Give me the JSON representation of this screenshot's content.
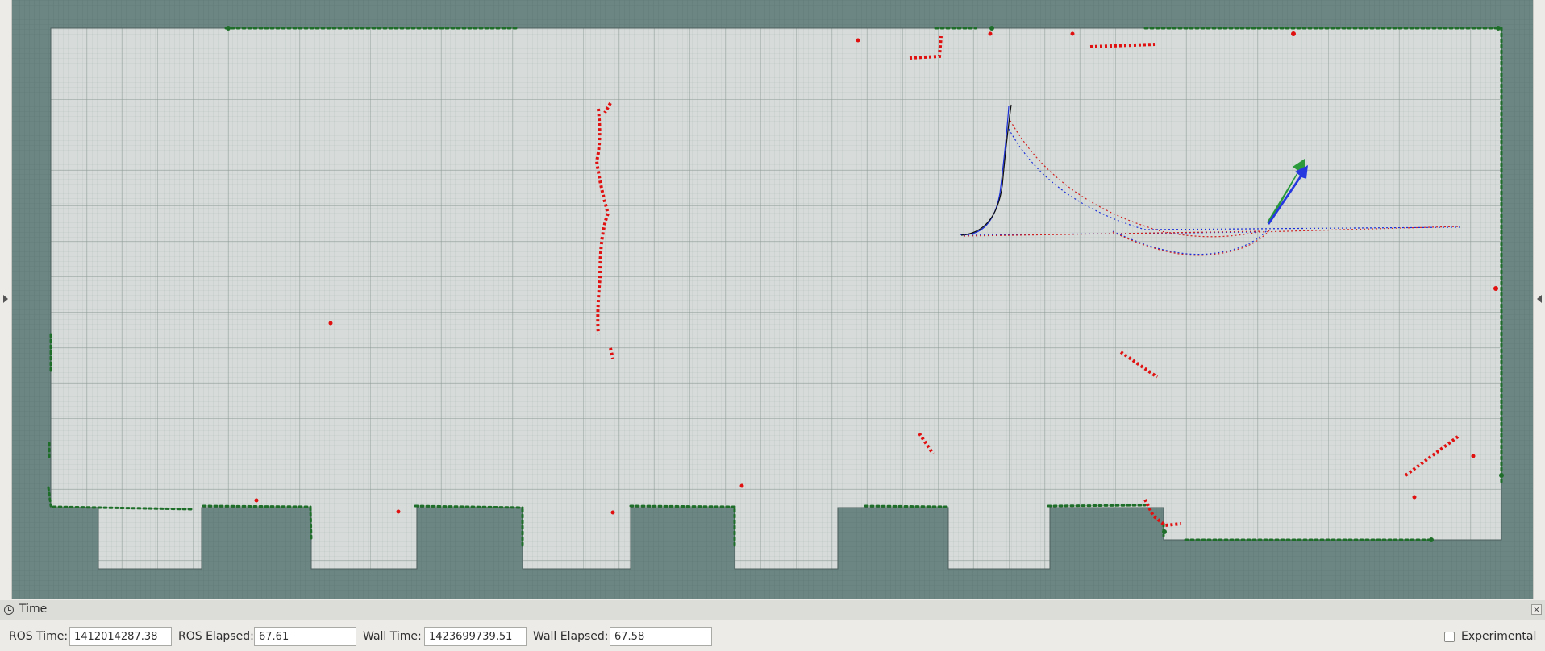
{
  "app": "rviz",
  "colors": {
    "unknown": "#6d8a87",
    "free": "#d7dcda",
    "obstacle_wall": "#1e6e2a",
    "laser": "#e01010",
    "path_blue": "#1a2ed8",
    "path_red": "#d02020",
    "pose_arrow_green": "#2a9a3a",
    "pose_arrow_blue": "#2538e0"
  },
  "time_panel": {
    "title": "Time",
    "ros_time_label": "ROS Time:",
    "ros_time_value": "1412014287.38",
    "ros_elapsed_label": "ROS Elapsed:",
    "ros_elapsed_value": "67.61",
    "wall_time_label": "Wall Time:",
    "wall_time_value": "1423699739.51",
    "wall_elapsed_label": "Wall Elapsed:",
    "wall_elapsed_value": "67.58",
    "experimental_label": "Experimental",
    "experimental_checked": false
  }
}
